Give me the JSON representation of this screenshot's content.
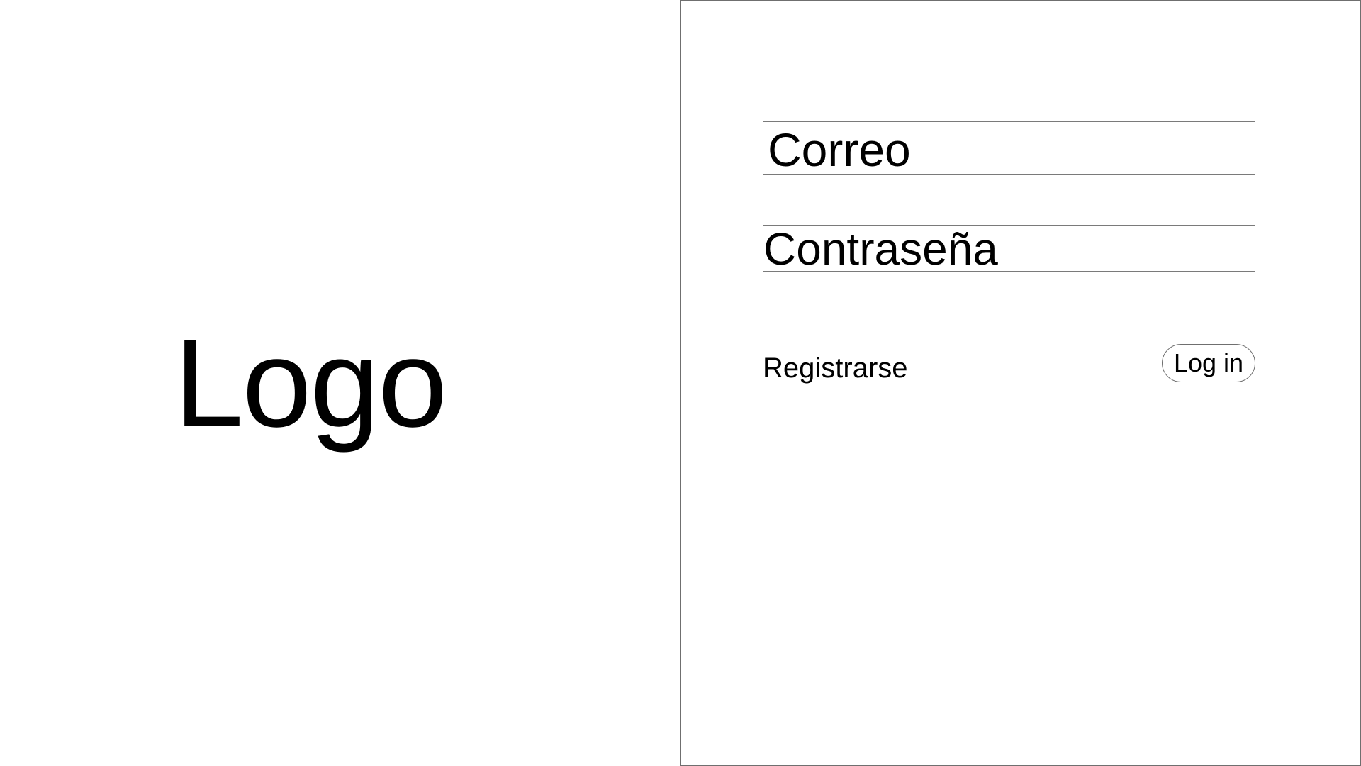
{
  "logo": {
    "text": "Logo"
  },
  "login_form": {
    "email_placeholder": "Correo",
    "password_placeholder": "Contraseña",
    "register_label": "Registrarse",
    "login_label": "Log in"
  },
  "colors": {
    "background": "#ffffff",
    "text": "#000000",
    "border": "#7a7a7a"
  }
}
